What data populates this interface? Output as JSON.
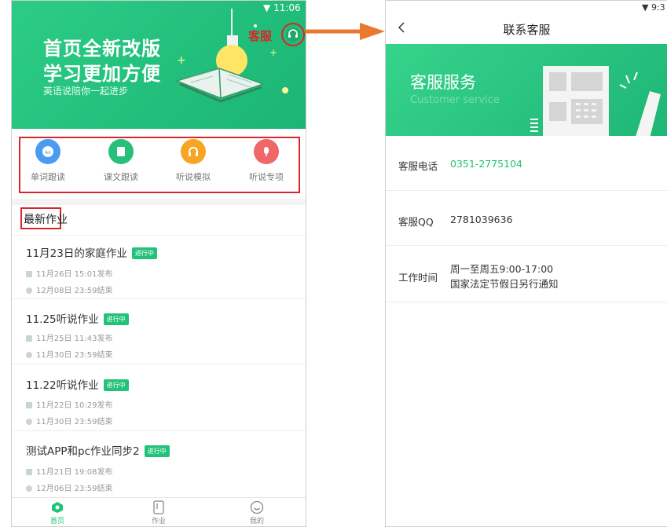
{
  "left_screen": {
    "status_time": "11:06",
    "hero": {
      "title_line1": "首页全新改版",
      "title_line2": "学习更加方便",
      "subtitle": "英语说陪你一起进步",
      "annotation_label": "客服"
    },
    "quick_actions": [
      {
        "label": "单词跟读",
        "icon": "abc-icon",
        "color": "#4a9cf0"
      },
      {
        "label": "课文跟读",
        "icon": "book-icon",
        "color": "#27c07b"
      },
      {
        "label": "听说模拟",
        "icon": "headphones-icon",
        "color": "#f6a623"
      },
      {
        "label": "听说专项",
        "icon": "microphone-icon",
        "color": "#f06767"
      }
    ],
    "section_title": "最新作业",
    "homework": [
      {
        "title": "11月23日的家庭作业",
        "status": "进行中",
        "published": "11月26日 15:01发布",
        "deadline": "12月08日 23:59结束"
      },
      {
        "title": "11.25听说作业",
        "status": "进行中",
        "published": "11月25日 11:43发布",
        "deadline": "11月30日 23:59结束"
      },
      {
        "title": "11.22听说作业",
        "status": "进行中",
        "published": "11月22日 10:29发布",
        "deadline": "11月30日 23:59结束"
      },
      {
        "title": "测试APP和pc作业同步2",
        "status": "进行中",
        "published": "11月21日 19:08发布",
        "deadline": "12月06日 23:59结束"
      }
    ],
    "tabs": [
      {
        "label": "首页",
        "active": true
      },
      {
        "label": "作业",
        "active": false
      },
      {
        "label": "我的",
        "active": false
      }
    ]
  },
  "right_screen": {
    "status_time": "9:3",
    "header_title": "联系客服",
    "banner_title": "客服服务",
    "banner_subtitle": "Customer service",
    "rows": [
      {
        "label": "客服电话",
        "value": "0351-2775104"
      },
      {
        "label": "客服QQ",
        "value": "2781039636"
      },
      {
        "label": "工作时间",
        "value_line1": "周一至周五9:00-17:00",
        "value_line2": "国家法定节假日另行通知"
      }
    ]
  },
  "colors": {
    "brand_green": "#22c27a",
    "annotation_red": "#d8262a",
    "arrow_orange": "#e8792e"
  }
}
